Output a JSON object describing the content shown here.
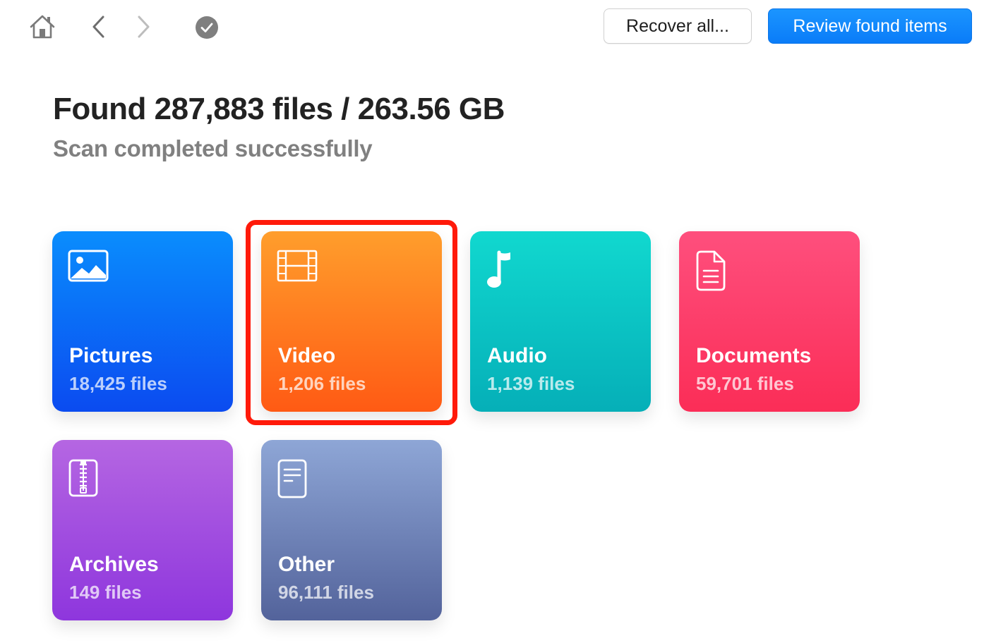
{
  "toolbar": {
    "recover_all_label": "Recover all...",
    "review_label": "Review found items",
    "icons": {
      "home": "home-icon",
      "back": "chevron-left-icon",
      "forward": "chevron-right-icon",
      "status": "checkmark-circle-icon"
    }
  },
  "summary": {
    "title": "Found 287,883 files / 263.56 GB",
    "subtitle": "Scan completed successfully"
  },
  "categories": [
    {
      "name": "Pictures",
      "count": "18,425 files",
      "icon": "image-icon",
      "color_top": "#0a8dfd",
      "color_bottom": "#0b4bf0"
    },
    {
      "name": "Video",
      "count": "1,206 files",
      "icon": "film-icon",
      "color_top": "#ff9e2c",
      "color_bottom": "#ff5a14",
      "highlighted": true
    },
    {
      "name": "Audio",
      "count": "1,139 files",
      "icon": "music-note-icon",
      "color_top": "#11d8cf",
      "color_bottom": "#05afb8"
    },
    {
      "name": "Documents",
      "count": "59,701 files",
      "icon": "document-icon",
      "color_top": "#fe4f7d",
      "color_bottom": "#fb2d57"
    },
    {
      "name": "Archives",
      "count": "149 files",
      "icon": "archive-zip-icon",
      "color_top": "#b566e2",
      "color_bottom": "#8e36dd"
    },
    {
      "name": "Other",
      "count": "96,111 files",
      "icon": "file-text-icon",
      "color_top": "#8ea6d6",
      "color_bottom": "#53639b"
    }
  ],
  "colors": {
    "primary_button": "#0a7cf8",
    "highlight_border": "#ff1a0a",
    "title_text": "#222222",
    "subtitle_text": "#808080"
  }
}
